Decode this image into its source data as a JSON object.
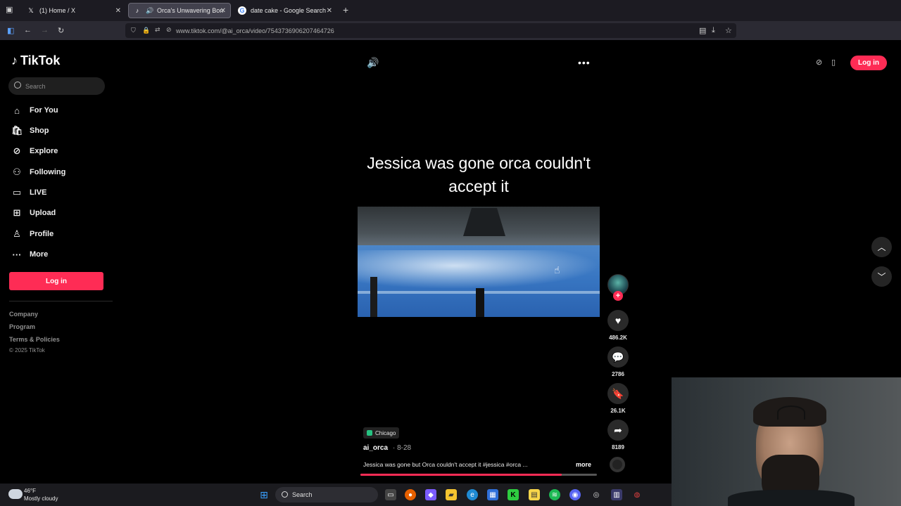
{
  "browser": {
    "tabs": [
      {
        "title": "(1) Home / X",
        "icon": "x-logo-icon"
      },
      {
        "title": "Orca's Unwavering Bond: F",
        "icon": "tiktok-logo-icon"
      },
      {
        "title": "date cake - Google Search",
        "icon": "google-logo-icon"
      }
    ],
    "url": "www.tiktok.com/@ai_orca/video/7543736906207464726"
  },
  "sidebar": {
    "logo": "TikTok",
    "search_placeholder": "Search",
    "items": [
      {
        "label": "For You",
        "icon": "home-icon"
      },
      {
        "label": "Shop",
        "icon": "shop-bag-icon"
      },
      {
        "label": "Explore",
        "icon": "compass-icon"
      },
      {
        "label": "Following",
        "icon": "following-icon"
      },
      {
        "label": "LIVE",
        "icon": "live-icon"
      },
      {
        "label": "Upload",
        "icon": "upload-icon"
      },
      {
        "label": "Profile",
        "icon": "profile-icon"
      },
      {
        "label": "More",
        "icon": "more-dots-icon"
      }
    ],
    "login_label": "Log in",
    "footer_links": [
      "Company",
      "Program",
      "Terms & Policies"
    ],
    "copyright": "© 2025 TikTok"
  },
  "video": {
    "overlay_text": "Jessica was gone orca couldn't accept it",
    "location": "Chicago",
    "author": "ai_orca",
    "date": "· 8-28",
    "description": "Jessica was gone but Orca couldn't accept it #jessica #orca ...",
    "more_label": "more",
    "progress": 0.85
  },
  "actions": {
    "likes": "486.2K",
    "comments": "2786",
    "saves": "26.1K",
    "shares": "8189"
  },
  "header": {
    "login_label": "Log in"
  },
  "taskbar": {
    "temperature": "46°F",
    "weather": "Mostly cloudy",
    "search_label": "Search"
  },
  "colors": {
    "accent": "#fe2c55",
    "background": "#000000"
  }
}
